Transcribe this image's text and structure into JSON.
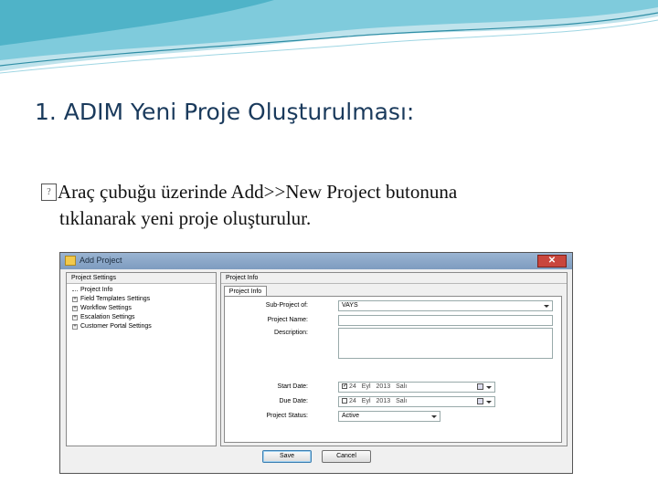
{
  "slide": {
    "title": "1. ADIM Yeni Proje Oluşturulması:",
    "bullet_marker": "?",
    "bullet_line1": "Araç çubuğu üzerinde Add>>New Project butonuna",
    "bullet_line2": "tıklanarak yeni proje oluşturulur."
  },
  "window": {
    "title": "Add Project",
    "close_glyph": "✕"
  },
  "left_panel": {
    "header": "Project Settings",
    "items": [
      {
        "label": "Project Info",
        "expander": ""
      },
      {
        "label": "Field Templates Settings",
        "expander": "+"
      },
      {
        "label": "Workflow Settings",
        "expander": "+"
      },
      {
        "label": "Escalation Settings",
        "expander": "+"
      },
      {
        "label": "Customer Portal Settings",
        "expander": "+"
      }
    ]
  },
  "right_panel": {
    "header": "Project Info",
    "tab": "Project Info",
    "fields": {
      "sub_project_of": {
        "label": "Sub-Project of:",
        "value": "VAYS"
      },
      "project_name": {
        "label": "Project Name:",
        "value": ""
      },
      "description": {
        "label": "Description:",
        "value": ""
      },
      "start_date": {
        "label": "Start Date:",
        "day": "24",
        "month": "Eyl",
        "year": "2013",
        "weekday": "Salı",
        "checked": true
      },
      "due_date": {
        "label": "Due Date:",
        "day": "24",
        "month": "Eyl",
        "year": "2013",
        "weekday": "Salı",
        "checked": false
      },
      "project_status": {
        "label": "Project Status:",
        "value": "Active"
      }
    }
  },
  "buttons": {
    "save": "Save",
    "cancel": "Cancel"
  },
  "colors": {
    "title_text": "#1a3a5c",
    "deco_teal": "#4fb3c8",
    "titlebar": "#8aa8cc",
    "close_button": "#c9463d"
  }
}
